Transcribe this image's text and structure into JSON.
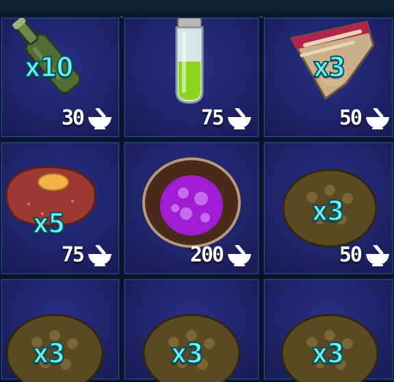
{
  "header": {
    "title": ""
  },
  "items": [
    {
      "name": "bottle",
      "quantity": "x10",
      "cost": "30"
    },
    {
      "name": "green-vial",
      "quantity": "",
      "cost": "75"
    },
    {
      "name": "berry-pie",
      "quantity": "x3",
      "cost": "50"
    },
    {
      "name": "raw-meat",
      "quantity": "x5",
      "cost": "75"
    },
    {
      "name": "purple-coconut",
      "quantity": "",
      "cost": "200"
    },
    {
      "name": "dung-pile",
      "quantity": "x3",
      "cost": "50"
    },
    {
      "name": "dung-pile",
      "quantity": "x3",
      "cost": ""
    },
    {
      "name": "dung-pile",
      "quantity": "x3",
      "cost": ""
    },
    {
      "name": "dung-pile",
      "quantity": "x3",
      "cost": ""
    }
  ],
  "colors": {
    "panel": "#20246b",
    "quantity_text": "#64f2f2",
    "cost_text": "#ffffff",
    "border_glow": "#3cbee6"
  },
  "icons": {
    "cost": "mortar-pestle-icon"
  }
}
